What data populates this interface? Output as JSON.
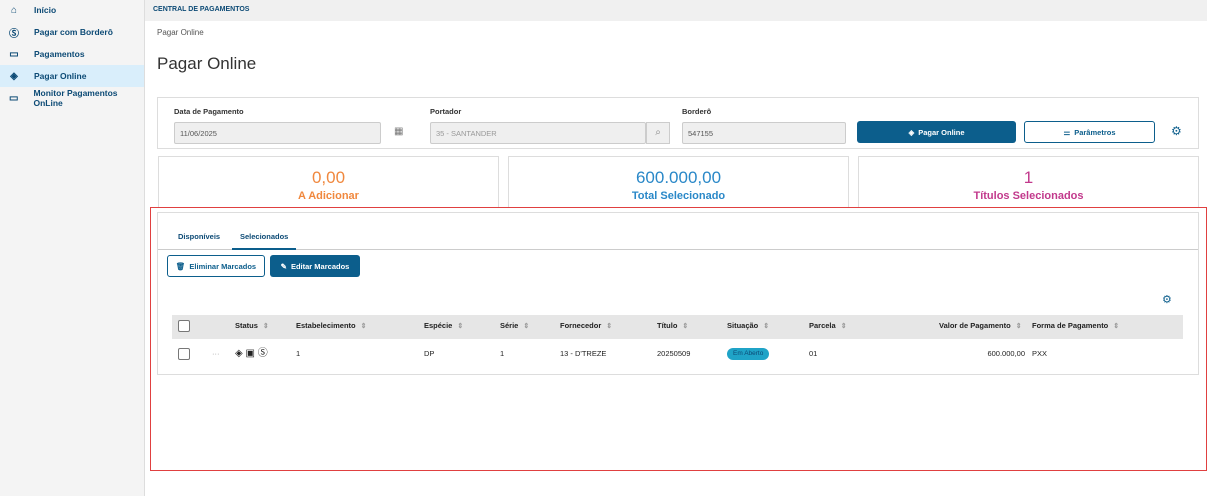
{
  "sidebar": {
    "items": [
      {
        "label": "Início",
        "icon": "home-icon"
      },
      {
        "label": "Pagar com Borderô",
        "icon": "dollar-circle-icon"
      },
      {
        "label": "Pagamentos",
        "icon": "wallet-icon"
      },
      {
        "label": "Pagar Online",
        "icon": "diamond-arrows-icon",
        "active": true
      },
      {
        "label": "Monitor Pagamentos OnLine",
        "icon": "monitor-icon"
      }
    ]
  },
  "header": {
    "title": "CENTRAL DE PAGAMENTOS"
  },
  "breadcrumb": "Pagar Online",
  "page_title": "Pagar Online",
  "filters": {
    "data_label": "Data de Pagamento",
    "data_value": "11/06/2025",
    "portador_label": "Portador",
    "portador_value": "35 - SANTANDER",
    "bordero_label": "Borderô",
    "bordero_value": "547155",
    "pagar_online_button": "Pagar Online",
    "parametros_button": "Parâmetros"
  },
  "summary": [
    {
      "value": "0,00",
      "label": "A Adicionar",
      "color": "#f0883e"
    },
    {
      "value": "600.000,00",
      "label": "Total Selecionado",
      "color": "#2a88c8"
    },
    {
      "value": "1",
      "label": "Títulos Selecionados",
      "color": "#c2398c"
    }
  ],
  "tabs": [
    {
      "label": "Disponíveis"
    },
    {
      "label": "Selecionados",
      "active": true
    }
  ],
  "actions": {
    "eliminar": "Eliminar Marcados",
    "editar": "Editar Marcados"
  },
  "table": {
    "columns": [
      "Status",
      "Estabelecimento",
      "Espécie",
      "Série",
      "Fornecedor",
      "Título",
      "Situação",
      "Parcela",
      "Valor de Pagamento",
      "Forma de Pagamento"
    ],
    "rows": [
      {
        "estabelecimento": "1",
        "especie": "DP",
        "serie": "1",
        "fornecedor": "13 - D'TREZE",
        "titulo": "20250509",
        "situacao": "Em Aberto",
        "parcela": "01",
        "valor": "600.000,00",
        "forma": "PXX"
      }
    ]
  },
  "colors": {
    "accent": "#0c5e8c",
    "badge": "#1fa3c7",
    "highlight_border": "#e04040"
  }
}
